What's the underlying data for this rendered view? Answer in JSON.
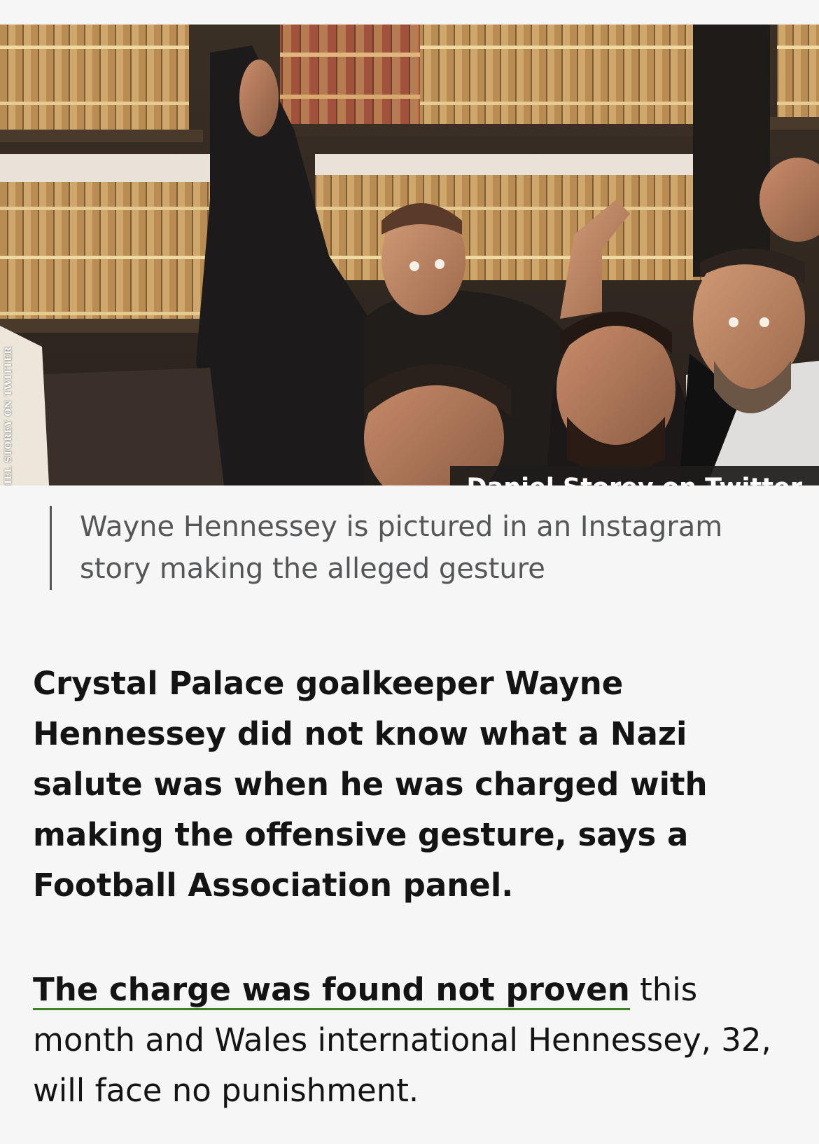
{
  "figure": {
    "image_description_name": "photo-of-group",
    "watermark": "DANIEL STOREY ON TWITTER",
    "credit": "Daniel Storey on Twitter"
  },
  "caption": {
    "text": "Wayne Hennessey is pictured in an Instagram story making the alleged gesture"
  },
  "article": {
    "intro": "Crystal Palace goalkeeper Wayne Hennessey did not know what a Nazi salute was when he was charged with making the offensive gesture, says a Football Association panel.",
    "para1_link": "The charge was found not proven",
    "para1_rest": " this month and Wales international Hennessey, 32, will face no punishment."
  },
  "colors": {
    "background": "#f6f6f6",
    "text": "#141414",
    "caption_text": "#545658",
    "link_underline": "#3d7f23",
    "credit_background": "#1e1c1b"
  }
}
